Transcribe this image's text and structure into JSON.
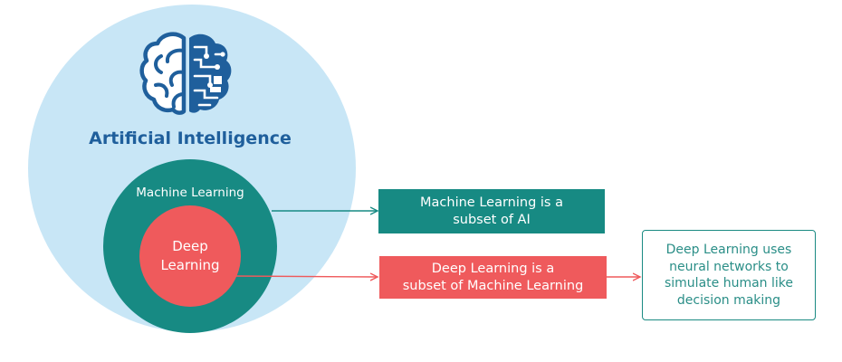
{
  "ai": {
    "label": "Artificial Intelligence",
    "icon": "brain-circuit-icon",
    "color": "#1f5f9c",
    "circle_color": "#c8e6f6"
  },
  "ml": {
    "label": "Machine Learning",
    "circle_color": "#178a83"
  },
  "dl": {
    "label": "Deep\nLearning",
    "circle_color": "#ef5a5c"
  },
  "callouts": {
    "ml_box": "Machine Learning is a\nsubset of AI",
    "dl_box": "Deep Learning is a\nsubset of Machine Learning",
    "note": "Deep Learning uses\nneural networks to\nsimulate human like\ndecision making"
  }
}
